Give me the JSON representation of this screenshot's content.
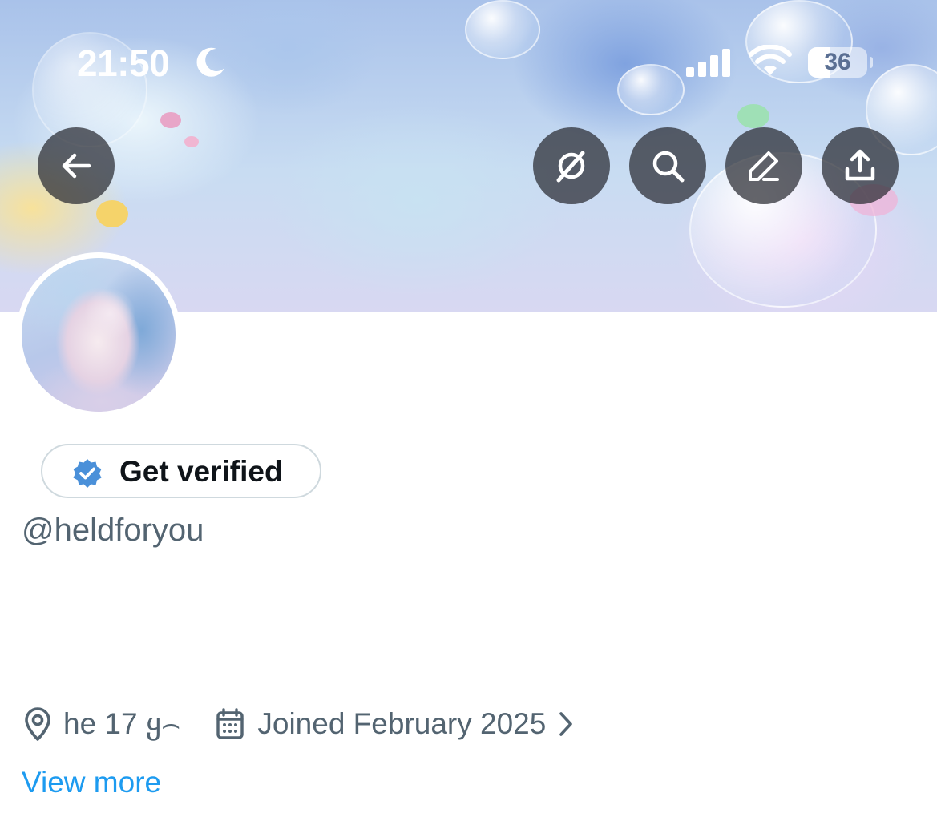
{
  "status_bar": {
    "time": "21:50",
    "battery": "36",
    "battery_level": 0.36,
    "icons": [
      "moon-icon",
      "signal-icon",
      "wifi-icon",
      "battery-icon"
    ]
  },
  "header_actions": {
    "back": "arrow-left-icon",
    "grok": "grok-icon",
    "search": "search-icon",
    "edit": "edit-icon",
    "share": "share-icon"
  },
  "profile": {
    "verify_label": "Get verified",
    "verify_badge_color": "#4a90d9",
    "handle": "@heldforyou",
    "location": "he 17 ყ⌢",
    "joined": "Joined February 2025",
    "view_more": "View more",
    "link_color": "#1d9bf0"
  }
}
